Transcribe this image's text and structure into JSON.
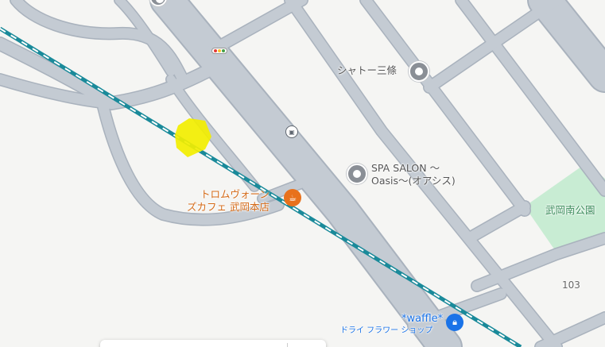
{
  "map": {
    "colors": {
      "land": "#f5f5f3",
      "road": "#c4cbd3",
      "road_edge": "#a9b2bd",
      "park": "#c8ecd3",
      "rail_main": "#1a8a9a",
      "highlight": "#f2ee00"
    }
  },
  "places": [
    {
      "name": "シャトー三條",
      "icon": "gray-place-pin"
    },
    {
      "name_line1": "SPA SALON 〜",
      "name_line2": "Oasis〜(オアシス)",
      "icon": "gray-place-pin"
    },
    {
      "name_line1": "トロムヴォーン",
      "name_line2": "ズカフェ 武岡本店",
      "icon": "cafe-icon",
      "color": "#e8711c"
    },
    {
      "name": "*waffle*",
      "subtitle": "ドライ フラワー ショップ",
      "icon": "shopping-bag-icon",
      "color": "#1a73e8"
    }
  ],
  "park": {
    "name": "武岡南公園"
  },
  "route_number": "103",
  "markers": {
    "bus_stop": "bus-stop-icon",
    "traffic_signal": "traffic-signal-icon"
  }
}
